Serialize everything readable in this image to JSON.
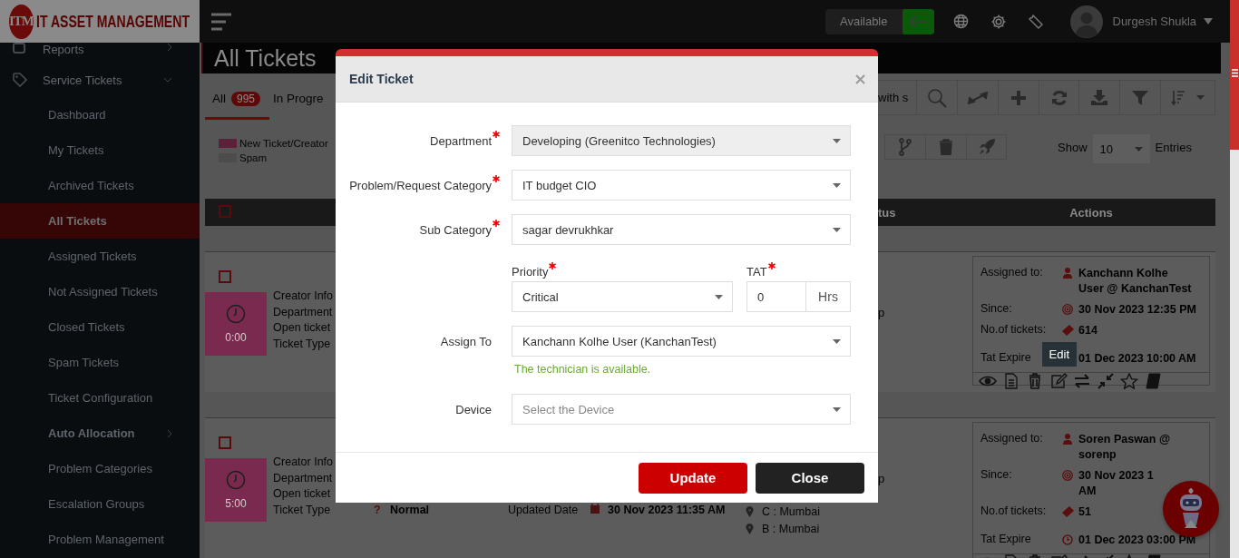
{
  "header": {
    "logo_mark": "ITM",
    "logo_text": "IT ASSET MANAGEMENT",
    "status": "Available",
    "user": "Durgesh Shukla"
  },
  "sidebar": {
    "items": [
      {
        "label": "Reports",
        "expanded": false
      },
      {
        "label": "Service Tickets",
        "expanded": true,
        "children": [
          {
            "label": "Dashboard",
            "selected": false
          },
          {
            "label": "My Tickets",
            "selected": false
          },
          {
            "label": "Archived Tickets",
            "selected": false
          },
          {
            "label": "All Tickets",
            "selected": true
          },
          {
            "label": "Assigned Tickets",
            "selected": false
          },
          {
            "label": "Not Assigned Tickets",
            "selected": false
          },
          {
            "label": "Closed Tickets",
            "selected": false
          },
          {
            "label": "Spam Tickets",
            "selected": false
          },
          {
            "label": "Ticket Configuration",
            "selected": false
          },
          {
            "label": "Auto Allocation",
            "selected": false,
            "expanded": false
          },
          {
            "label": "Problem Categories",
            "selected": false
          },
          {
            "label": "Escalation Groups",
            "selected": false
          },
          {
            "label": "Problem Management",
            "selected": false
          }
        ]
      }
    ]
  },
  "page": {
    "title": "All Tickets",
    "tabs": [
      {
        "label": "All",
        "count": "995",
        "selected": true
      },
      {
        "label": "In Progre",
        "selected": false
      }
    ],
    "legend": [
      {
        "label": "New Ticket/Creator",
        "color": "#5c2139"
      },
      {
        "label": "Spam",
        "color": "#4c4c4c"
      }
    ],
    "search": {
      "placeholder": "with s"
    },
    "show_label": "Show",
    "page_size": "10",
    "entries_label": "Entries"
  },
  "table": {
    "header_checked": false,
    "columns": [
      "tus",
      "Actions"
    ],
    "rows": [
      {
        "checked": false,
        "timer": "0:00",
        "labels": [
          "Creator Info",
          "Department",
          "Open ticket",
          "Ticket Type"
        ],
        "column_5": "p",
        "assignment": {
          "tooltip": "Edit",
          "fields": [
            {
              "kind": "assignee",
              "label": "Assigned to:",
              "value": [
                "Kanchann Kolhe",
                "User @ KanchanTest"
              ]
            },
            {
              "kind": "since",
              "label": "Since:",
              "value": [
                "30 Nov 2023 12:35 PM"
              ]
            },
            {
              "kind": "count",
              "label": "No.of tickets:",
              "value": [
                "614"
              ]
            },
            {
              "kind": "expire",
              "label": "Tat Expire",
              "value": [
                "01 Dec 2023 10:00 AM"
              ]
            }
          ]
        }
      },
      {
        "checked": false,
        "timer": "5:00",
        "labels": [
          "Creator Info",
          "Department",
          "Open ticket",
          "Ticket Type"
        ],
        "column_5": "p",
        "type_mark": "?",
        "ticket_type": "Normal",
        "updated_label": "Updated Date",
        "updated": "30 Nov 2023 11:35 AM",
        "locations": [
          "C : Mumbai",
          "B : Mumbai"
        ],
        "assignment": {
          "fields": [
            {
              "kind": "assignee",
              "label": "Assigned to:",
              "value": [
                "Soren Paswan @",
                "sorenp"
              ]
            },
            {
              "kind": "since",
              "label": "Since:",
              "value": [
                "30 Nov 2023 1",
                "AM"
              ]
            },
            {
              "kind": "count",
              "label": "No.of tickets:",
              "value": [
                "51"
              ]
            },
            {
              "kind": "expire",
              "label": "Tat Expire",
              "value": [
                "01 Dec 2023 03:00 PM"
              ]
            }
          ]
        }
      }
    ]
  },
  "modal": {
    "title": "Edit Ticket",
    "fields": [
      {
        "kind": "select",
        "label": "Department",
        "required": true,
        "disabled": true,
        "value": "Developing (Greenitco Technologies)"
      },
      {
        "kind": "select",
        "label": "Problem/Request Category",
        "required": true,
        "disabled": false,
        "value": "IT budget CIO"
      },
      {
        "kind": "select",
        "label": "Sub Category",
        "required": true,
        "disabled": false,
        "value": "sagar devrukhkar"
      }
    ],
    "priority": {
      "label": "Priority",
      "required": true,
      "value": "Critical"
    },
    "tat": {
      "label": "TAT",
      "required": true,
      "value": "0",
      "unit": "Hrs"
    },
    "assign": {
      "label": "Assign To",
      "value": "Kanchann Kolhe User (KanchanTest)",
      "hint": "The technician is available."
    },
    "device": {
      "label": "Device",
      "placeholder": "Select the Device"
    },
    "buttons": [
      {
        "label": "Update",
        "kind": "primary"
      },
      {
        "label": "Close",
        "kind": "secondary"
      }
    ]
  }
}
